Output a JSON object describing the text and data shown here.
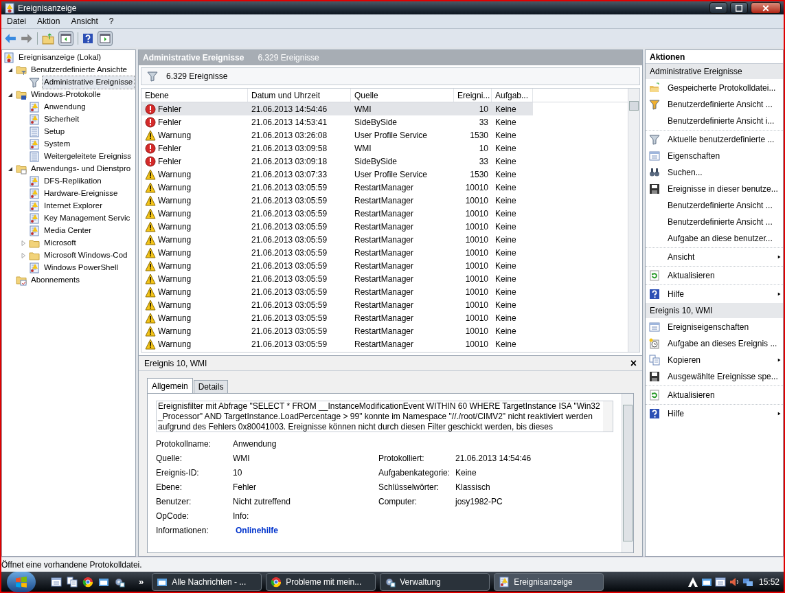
{
  "window": {
    "title": "Ereignisanzeige"
  },
  "menu": [
    "Datei",
    "Aktion",
    "Ansicht",
    "?"
  ],
  "toolbar": [
    {
      "kind": "back"
    },
    {
      "kind": "forward"
    },
    {
      "kind": "sep"
    },
    {
      "kind": "up"
    },
    {
      "kind": "pane-left"
    },
    {
      "kind": "sep"
    },
    {
      "kind": "help"
    },
    {
      "kind": "pane-right"
    }
  ],
  "tree": [
    {
      "label": "Ereignisanzeige (Lokal)",
      "kind": "root",
      "selected": false,
      "children": [
        {
          "label": "Benutzerdefinierte Ansichte",
          "kind": "folder-filter",
          "selected": false,
          "expanded": true,
          "children": [
            {
              "label": "Administrative Ereignisse",
              "kind": "filter",
              "selected": true
            }
          ]
        },
        {
          "label": "Windows-Protokolle",
          "kind": "folder-pc",
          "selected": false,
          "expanded": true,
          "children": [
            {
              "label": "Anwendung",
              "kind": "log",
              "selected": false
            },
            {
              "label": "Sicherheit",
              "kind": "log",
              "selected": false
            },
            {
              "label": "Setup",
              "kind": "plain-log",
              "selected": false
            },
            {
              "label": "System",
              "kind": "log",
              "selected": false
            },
            {
              "label": "Weitergeleitete Ereigniss",
              "kind": "plain-log",
              "selected": false
            }
          ]
        },
        {
          "label": "Anwendungs- und Dienstpro",
          "kind": "folder-doc",
          "selected": false,
          "expanded": true,
          "children": [
            {
              "label": "DFS-Replikation",
              "kind": "log",
              "selected": false
            },
            {
              "label": "Hardware-Ereignisse",
              "kind": "log",
              "selected": false
            },
            {
              "label": "Internet Explorer",
              "kind": "log",
              "selected": false
            },
            {
              "label": "Key Management Servic",
              "kind": "log",
              "selected": false
            },
            {
              "label": "Media Center",
              "kind": "log",
              "selected": false
            },
            {
              "label": "Microsoft",
              "kind": "folder",
              "selected": false,
              "expanded": false
            },
            {
              "label": "Microsoft Windows-Cod",
              "kind": "folder",
              "selected": false,
              "expanded": false
            },
            {
              "label": "Windows PowerShell",
              "kind": "log",
              "selected": false
            }
          ]
        },
        {
          "label": "Abonnements",
          "kind": "folder-sub",
          "selected": false
        }
      ]
    }
  ],
  "header": {
    "title": "Administrative Ereignisse",
    "count": "6.329 Ereignisse"
  },
  "filter_bar": {
    "text": "6.329 Ereignisse"
  },
  "table": {
    "columns": [
      "Ebene",
      "Datum und Uhrzeit",
      "Quelle",
      "Ereigni...",
      "Aufgab..."
    ],
    "rows": [
      {
        "kind": "error",
        "level_text": "Fehler",
        "date": "21.06.2013 14:54:46",
        "source": "WMI",
        "id": "10",
        "task": "Keine",
        "selected": true
      },
      {
        "kind": "error",
        "level_text": "Fehler",
        "date": "21.06.2013 14:53:41",
        "source": "SideBySide",
        "id": "33",
        "task": "Keine",
        "selected": false
      },
      {
        "kind": "warning",
        "level_text": "Warnung",
        "date": "21.06.2013 03:26:08",
        "source": "User Profile Service",
        "id": "1530",
        "task": "Keine",
        "selected": false
      },
      {
        "kind": "error",
        "level_text": "Fehler",
        "date": "21.06.2013 03:09:58",
        "source": "WMI",
        "id": "10",
        "task": "Keine",
        "selected": false
      },
      {
        "kind": "error",
        "level_text": "Fehler",
        "date": "21.06.2013 03:09:18",
        "source": "SideBySide",
        "id": "33",
        "task": "Keine",
        "selected": false
      },
      {
        "kind": "warning",
        "level_text": "Warnung",
        "date": "21.06.2013 03:07:33",
        "source": "User Profile Service",
        "id": "1530",
        "task": "Keine",
        "selected": false
      },
      {
        "kind": "warning",
        "level_text": "Warnung",
        "date": "21.06.2013 03:05:59",
        "source": "RestartManager",
        "id": "10010",
        "task": "Keine",
        "selected": false
      },
      {
        "kind": "warning",
        "level_text": "Warnung",
        "date": "21.06.2013 03:05:59",
        "source": "RestartManager",
        "id": "10010",
        "task": "Keine",
        "selected": false
      },
      {
        "kind": "warning",
        "level_text": "Warnung",
        "date": "21.06.2013 03:05:59",
        "source": "RestartManager",
        "id": "10010",
        "task": "Keine",
        "selected": false
      },
      {
        "kind": "warning",
        "level_text": "Warnung",
        "date": "21.06.2013 03:05:59",
        "source": "RestartManager",
        "id": "10010",
        "task": "Keine",
        "selected": false
      },
      {
        "kind": "warning",
        "level_text": "Warnung",
        "date": "21.06.2013 03:05:59",
        "source": "RestartManager",
        "id": "10010",
        "task": "Keine",
        "selected": false
      },
      {
        "kind": "warning",
        "level_text": "Warnung",
        "date": "21.06.2013 03:05:59",
        "source": "RestartManager",
        "id": "10010",
        "task": "Keine",
        "selected": false
      },
      {
        "kind": "warning",
        "level_text": "Warnung",
        "date": "21.06.2013 03:05:59",
        "source": "RestartManager",
        "id": "10010",
        "task": "Keine",
        "selected": false
      },
      {
        "kind": "warning",
        "level_text": "Warnung",
        "date": "21.06.2013 03:05:59",
        "source": "RestartManager",
        "id": "10010",
        "task": "Keine",
        "selected": false
      },
      {
        "kind": "warning",
        "level_text": "Warnung",
        "date": "21.06.2013 03:05:59",
        "source": "RestartManager",
        "id": "10010",
        "task": "Keine",
        "selected": false
      },
      {
        "kind": "warning",
        "level_text": "Warnung",
        "date": "21.06.2013 03:05:59",
        "source": "RestartManager",
        "id": "10010",
        "task": "Keine",
        "selected": false
      },
      {
        "kind": "warning",
        "level_text": "Warnung",
        "date": "21.06.2013 03:05:59",
        "source": "RestartManager",
        "id": "10010",
        "task": "Keine",
        "selected": false
      },
      {
        "kind": "warning",
        "level_text": "Warnung",
        "date": "21.06.2013 03:05:59",
        "source": "RestartManager",
        "id": "10010",
        "task": "Keine",
        "selected": false
      },
      {
        "kind": "warning",
        "level_text": "Warnung",
        "date": "21.06.2013 03:05:59",
        "source": "RestartManager",
        "id": "10010",
        "task": "Keine",
        "selected": false
      }
    ]
  },
  "detail": {
    "title": "Ereignis 10, WMI",
    "close": "×",
    "tabs": [
      {
        "label": "Allgemein",
        "selected": true
      },
      {
        "label": "Details",
        "selected": false
      }
    ],
    "description": "Ereignisfilter mit Abfrage \"SELECT * FROM __InstanceModificationEvent WITHIN 60 WHERE TargetInstance ISA \"Win32 _Processor\" AND TargetInstance.LoadPercentage > 99\" konnte im Namespace \"//./root/CIMV2\" nicht reaktiviert werden aufgrund des Fehlers 0x80041003. Ereignisse können nicht durch diesen Filter geschickt werden, bis dieses",
    "fields": [
      [
        {
          "label": "Protokollname:",
          "value": "Anwendung"
        }
      ],
      [
        {
          "label": "Quelle:",
          "value": "WMI"
        },
        {
          "label": "Protokolliert:",
          "value": "21.06.2013 14:54:46"
        }
      ],
      [
        {
          "label": "Ereignis-ID:",
          "value": "10"
        },
        {
          "label": "Aufgabenkategorie:",
          "value": "Keine"
        }
      ],
      [
        {
          "label": "Ebene:",
          "value": "Fehler"
        },
        {
          "label": "Schlüsselwörter:",
          "value": "Klassisch"
        }
      ],
      [
        {
          "label": "Benutzer:",
          "value": "Nicht zutreffend"
        },
        {
          "label": "Computer:",
          "value": "josy1982-PC"
        }
      ],
      [
        {
          "label": "OpCode:",
          "value": "Info:"
        }
      ],
      [
        {
          "label": "Informationen:",
          "value": "Onlinehilfe",
          "kind": "link"
        }
      ]
    ]
  },
  "actions": {
    "title": "Aktionen",
    "sections": [
      {
        "title": "Administrative Ereignisse",
        "groups": [
          [
            {
              "label": "Gespeicherte Protokolldatei...",
              "kind": "open"
            },
            {
              "label": "Benutzerdefinierte Ansicht ...",
              "kind": "filter-new"
            },
            {
              "label": "Benutzerdefinierte Ansicht i..."
            }
          ],
          [
            {
              "label": "Aktuelle benutzerdefinierte ...",
              "kind": "filter"
            },
            {
              "label": "Eigenschaften",
              "kind": "props"
            },
            {
              "label": "Suchen...",
              "kind": "find"
            },
            {
              "label": "Ereignisse in dieser benutze...",
              "kind": "save"
            },
            {
              "label": "Benutzerdefinierte Ansicht ..."
            },
            {
              "label": "Benutzerdefinierte Ansicht ..."
            },
            {
              "label": "Aufgabe an diese benutzer..."
            }
          ],
          [
            {
              "label": "Ansicht",
              "submenu": true
            }
          ],
          [
            {
              "label": "Aktualisieren",
              "kind": "refresh"
            }
          ],
          [
            {
              "label": "Hilfe",
              "kind": "help",
              "submenu": true
            }
          ]
        ]
      },
      {
        "title": "Ereignis 10, WMI",
        "groups": [
          [
            {
              "label": "Ereigniseigenschaften",
              "kind": "props"
            },
            {
              "label": "Aufgabe an dieses Ereignis ...",
              "kind": "task"
            },
            {
              "label": "Kopieren",
              "kind": "copy",
              "submenu": true
            },
            {
              "label": "Ausgewählte Ereignisse spe...",
              "kind": "save"
            }
          ],
          [
            {
              "label": "Aktualisieren",
              "kind": "refresh"
            }
          ],
          [
            {
              "label": "Hilfe",
              "kind": "help",
              "submenu": true
            }
          ]
        ]
      }
    ]
  },
  "status_bar": "Öffnet eine vorhandene Protokolldatei.",
  "taskbar": {
    "overflow": "»",
    "buttons": [
      {
        "label": "Alle Nachrichten - ...",
        "kind": "mail",
        "selected": false
      },
      {
        "label": "Probleme mit mein...",
        "kind": "browser",
        "selected": false
      },
      {
        "label": "Verwaltung",
        "kind": "gear",
        "selected": false
      },
      {
        "label": "Ereignisanzeige",
        "kind": "log",
        "selected": true
      }
    ],
    "clock": "15:52"
  }
}
